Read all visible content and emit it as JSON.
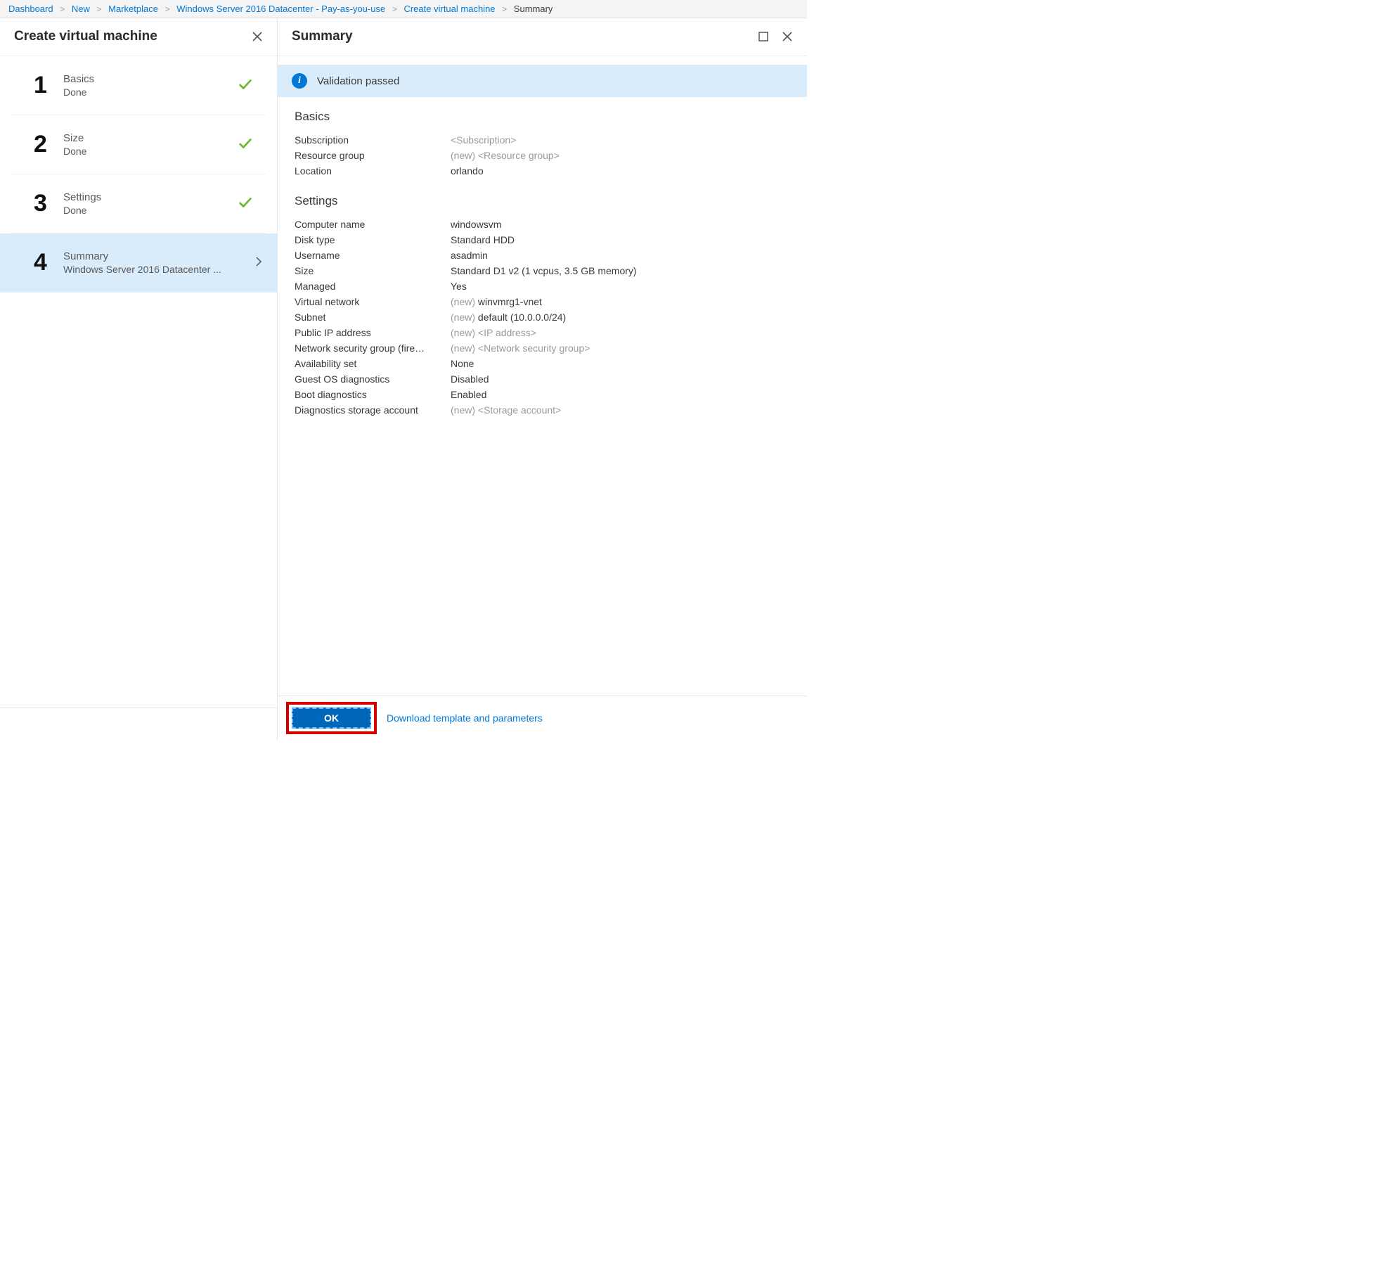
{
  "breadcrumb": {
    "items": [
      {
        "label": "Dashboard",
        "link": true
      },
      {
        "label": "New",
        "link": true
      },
      {
        "label": "Marketplace",
        "link": true
      },
      {
        "label": "Windows Server 2016 Datacenter - Pay-as-you-use",
        "link": true
      },
      {
        "label": "Create virtual machine",
        "link": true
      },
      {
        "label": "Summary",
        "link": false
      }
    ]
  },
  "leftPane": {
    "title": "Create virtual machine",
    "steps": [
      {
        "num": "1",
        "title": "Basics",
        "sub": "Done",
        "done": true,
        "active": false
      },
      {
        "num": "2",
        "title": "Size",
        "sub": "Done",
        "done": true,
        "active": false
      },
      {
        "num": "3",
        "title": "Settings",
        "sub": "Done",
        "done": true,
        "active": false
      },
      {
        "num": "4",
        "title": "Summary",
        "sub": "Windows Server 2016 Datacenter ...",
        "done": false,
        "active": true
      }
    ]
  },
  "rightPane": {
    "title": "Summary",
    "validation": "Validation passed",
    "sections": [
      {
        "title": "Basics",
        "rows": [
          {
            "label": "Subscription",
            "new": "",
            "value": "<Subscription>",
            "ph": true
          },
          {
            "label": "Resource group",
            "new": "(new)",
            "value": "<Resource group>",
            "ph": true
          },
          {
            "label": "Location",
            "new": "",
            "value": "orlando",
            "ph": false
          }
        ]
      },
      {
        "title": "Settings",
        "rows": [
          {
            "label": "Computer name",
            "new": "",
            "value": "windowsvm",
            "ph": false
          },
          {
            "label": "Disk type",
            "new": "",
            "value": "Standard HDD",
            "ph": false
          },
          {
            "label": "Username",
            "new": "",
            "value": "asadmin",
            "ph": false
          },
          {
            "label": "Size",
            "new": "",
            "value": "Standard D1 v2 (1 vcpus, 3.5 GB memory)",
            "ph": false
          },
          {
            "label": "Managed",
            "new": "",
            "value": "Yes",
            "ph": false
          },
          {
            "label": "Virtual network",
            "new": "(new)",
            "value": "winvmrg1-vnet",
            "ph": false
          },
          {
            "label": "Subnet",
            "new": "(new)",
            "value": "default (10.0.0.0/24)",
            "ph": false
          },
          {
            "label": "Public IP address",
            "new": "(new)",
            "value": "<IP address>",
            "ph": true
          },
          {
            "label": "Network security group (fire…",
            "new": "(new)",
            "value": "<Network security group>",
            "ph": true
          },
          {
            "label": "Availability set",
            "new": "",
            "value": "None",
            "ph": false
          },
          {
            "label": "Guest OS diagnostics",
            "new": "",
            "value": "Disabled",
            "ph": false
          },
          {
            "label": "Boot diagnostics",
            "new": "",
            "value": "Enabled",
            "ph": false
          },
          {
            "label": "Diagnostics storage account",
            "new": "(new)",
            "value": "<Storage account>",
            "ph": true
          }
        ]
      }
    ],
    "okLabel": "OK",
    "downloadLabel": "Download template and parameters"
  }
}
